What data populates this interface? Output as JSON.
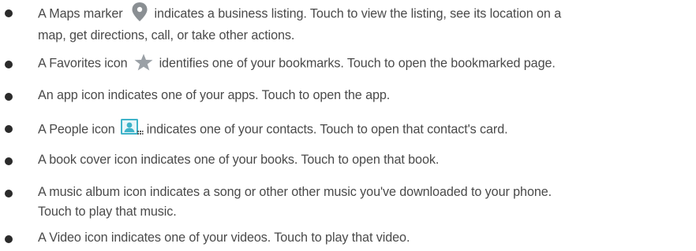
{
  "list": {
    "items": [
      {
        "line1_before": "A Maps marker",
        "icon": "map-pin-icon",
        "line1_after": "indicates a business listing. Touch to view the listing, see its location on a",
        "line2": "map, get directions, call, or take other actions."
      },
      {
        "line1_before": "A Favorites icon",
        "icon": "star-icon",
        "line1_after": "identifies one of your bookmarks. Touch to open the bookmarked page."
      },
      {
        "line1": "An app icon indicates one of your apps. Touch to open the app."
      },
      {
        "line1_before": "A People icon",
        "icon": "people-contact-icon",
        "line1_after": "indicates one of your contacts. Touch to open that contact's card."
      },
      {
        "line1": "A book cover icon indicates one of your books. Touch to open that book."
      },
      {
        "line1": "A music album icon indicates a song or other other music you've downloaded to your phone.",
        "line2": "Touch to play that music."
      },
      {
        "line1": "A Video icon indicates one of your videos. Touch to play that video."
      }
    ]
  },
  "colors": {
    "text": "#4a4a4a",
    "bullet": "#2b2b2b",
    "pin": "#8a8f93",
    "star": "#9aa0a6",
    "people_frame": "#3fb3c9"
  }
}
